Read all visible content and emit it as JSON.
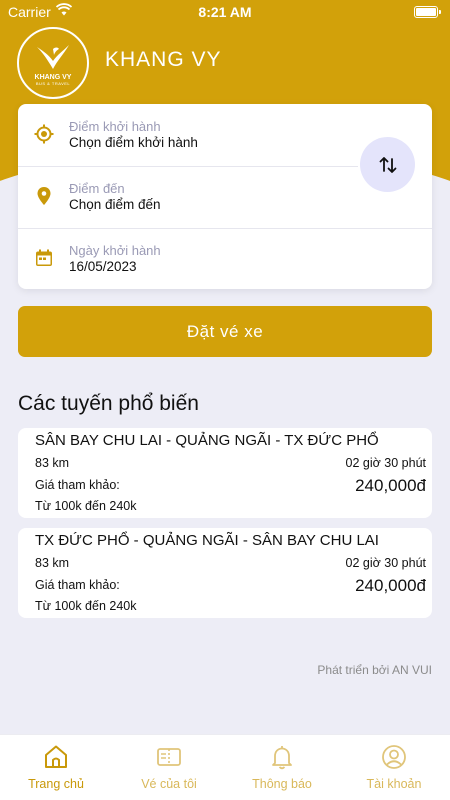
{
  "status_bar": {
    "carrier": "Carrier",
    "time": "8:21 AM"
  },
  "brand": {
    "logo_name": "KHANG VY",
    "logo_sub": "BUS & TRAVEL",
    "title": "KHANG VY"
  },
  "search": {
    "origin": {
      "label": "Điểm khởi hành",
      "value": "Chọn điểm khởi hành",
      "icon": "location-target-icon"
    },
    "destination": {
      "label": "Điểm đến",
      "value": "Chọn điểm đến",
      "icon": "map-pin-icon"
    },
    "date": {
      "label": "Ngày khởi hành",
      "value": "16/05/2023",
      "icon": "calendar-icon"
    },
    "swap_icon": "swap-vertical-icon"
  },
  "book_button": "Đặt vé xe",
  "popular": {
    "title": "Các tuyến phổ biến",
    "routes": [
      {
        "name": "SÂN BAY CHU LAI - QUẢNG NGÃI - TX ĐỨC PHỔ",
        "distance": "83 km",
        "duration": "02 giờ 30 phút",
        "price_label": "Giá tham khảo:",
        "price": "240,000đ",
        "range": "Từ 100k đến 240k"
      },
      {
        "name": "TX ĐỨC PHỔ - QUẢNG NGÃI - SÂN BAY CHU LAI",
        "distance": "83 km",
        "duration": "02 giờ 30 phút",
        "price_label": "Giá tham khảo:",
        "price": "240,000đ",
        "range": "Từ 100k đến 240k"
      }
    ]
  },
  "credit": "Phát triển bởi AN VUI",
  "tabs": [
    {
      "label": "Trang chủ",
      "icon": "home-icon",
      "active": true
    },
    {
      "label": "Vé của tôi",
      "icon": "ticket-icon",
      "active": false
    },
    {
      "label": "Thông báo",
      "icon": "bell-icon",
      "active": false
    },
    {
      "label": "Tài khoản",
      "icon": "account-icon",
      "active": false
    }
  ],
  "colors": {
    "accent": "#d2a10a",
    "background": "#ededf6",
    "swap_bg": "#e4e4fb"
  }
}
